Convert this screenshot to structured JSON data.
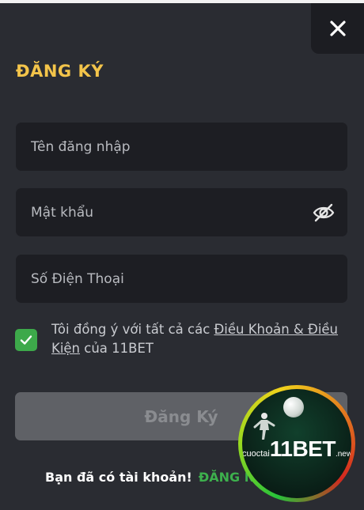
{
  "modal": {
    "close_glyph": "✕",
    "title": "ĐĂNG KÝ"
  },
  "form": {
    "username": {
      "placeholder": "Tên đăng nhập",
      "value": ""
    },
    "password": {
      "placeholder": "Mật khẩu",
      "value": ""
    },
    "phone": {
      "placeholder": "Số Điện Thoại",
      "value": ""
    },
    "terms": {
      "checked": true,
      "prefix": "Tôi đồng ý với tất cả các ",
      "link": "Điều Khoản & Điều Kiện",
      "suffix": " của 11BET"
    },
    "submit_label": "Đăng Ký",
    "submit_enabled": false
  },
  "footer": {
    "question": "Bạn đã có tài khoản!",
    "login_link": "ĐĂNG NH"
  },
  "watermark": {
    "prefix": "cuoctai",
    "brand": "11BET",
    "suffix": ".news"
  },
  "colors": {
    "background": "#2a2c32",
    "field": "#1d1e23",
    "accent_title": "#f3c44a",
    "checkbox": "#3da94a",
    "login_link": "#3db04d",
    "submit_disabled": "#5f6166"
  }
}
